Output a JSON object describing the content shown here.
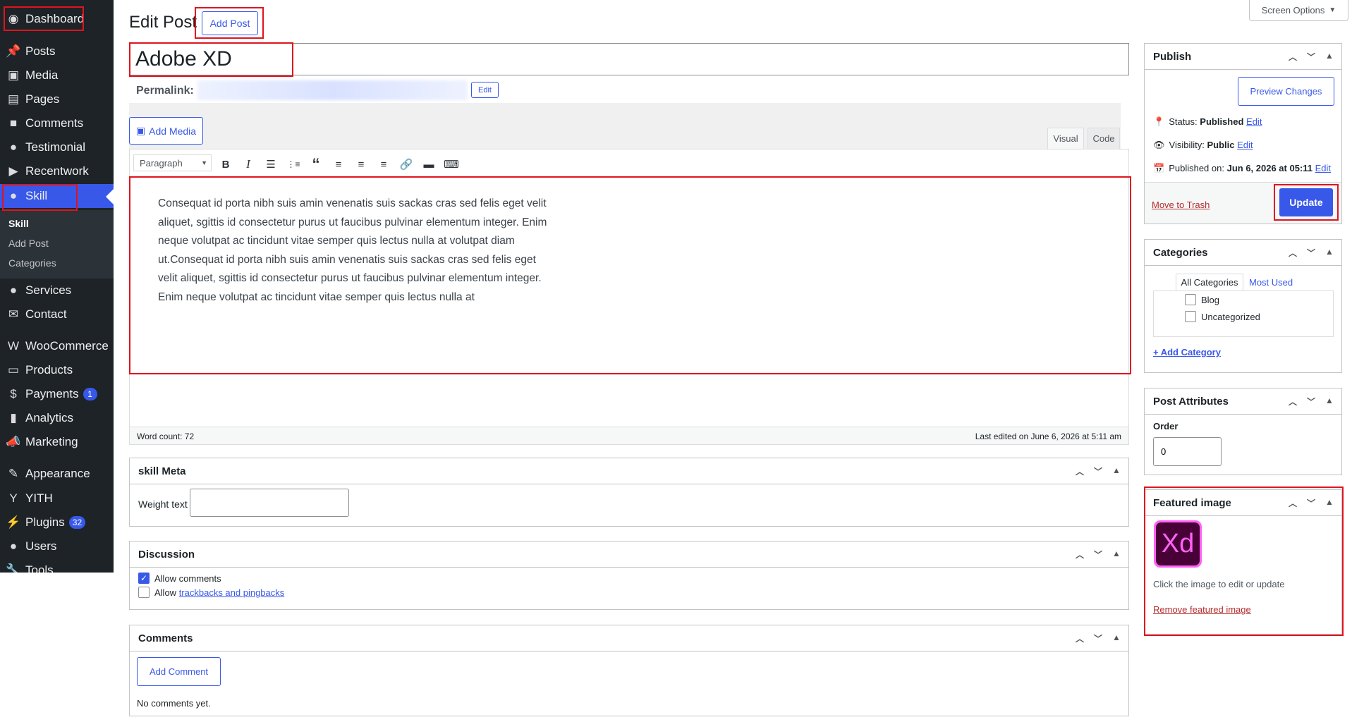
{
  "sidebar": {
    "items": [
      {
        "label": "Dashboard",
        "icon": "dashboard-icon"
      },
      {
        "label": "Posts",
        "icon": "pin-icon"
      },
      {
        "label": "Media",
        "icon": "media-icon"
      },
      {
        "label": "Pages",
        "icon": "pages-icon"
      },
      {
        "label": "Comments",
        "icon": "comments-icon"
      },
      {
        "label": "Testimonial",
        "icon": "user-icon"
      },
      {
        "label": "Recentwork",
        "icon": "video-icon"
      },
      {
        "label": "Skill",
        "icon": "user-icon"
      },
      {
        "label": "Services",
        "icon": "user-icon"
      },
      {
        "label": "Contact",
        "icon": "email-icon"
      },
      {
        "label": "WooCommerce",
        "icon": "woocommerce-icon"
      },
      {
        "label": "Products",
        "icon": "archive-icon"
      },
      {
        "label": "Payments",
        "icon": "dollar-icon",
        "badge": "1"
      },
      {
        "label": "Analytics",
        "icon": "chart-icon"
      },
      {
        "label": "Marketing",
        "icon": "megaphone-icon"
      },
      {
        "label": "Appearance",
        "icon": "brush-icon"
      },
      {
        "label": "YITH",
        "icon": "yith-icon"
      },
      {
        "label": "Plugins",
        "icon": "plug-icon",
        "badge": "32"
      },
      {
        "label": "Users",
        "icon": "user-icon"
      },
      {
        "label": "Tools",
        "icon": "wrench-icon"
      }
    ],
    "submenu": [
      "Skill",
      "Add Post",
      "Categories"
    ]
  },
  "screen_options": "Screen Options",
  "page_title": "Edit Post",
  "add_post_button": "Add Post",
  "post_title": "Adobe XD",
  "permalink_label": "Permalink:",
  "permalink_edit": "Edit",
  "add_media": "Add Media",
  "tabs": {
    "visual": "Visual",
    "code": "Code"
  },
  "format_select": "Paragraph",
  "content_lines": [
    "Consequat id porta nibh suis amin venenatis suis sackas cras sed felis eget velit",
    "aliquet, sgittis id consectetur purus ut faucibus pulvinar elementum integer. Enim",
    "neque volutpat ac tincidunt vitae semper quis lectus nulla at volutpat diam",
    "ut.Consequat id porta nibh suis amin venenatis suis sackas cras sed felis eget",
    "velit aliquet, sgittis id consectetur purus ut faucibus pulvinar elementum integer.",
    "Enim neque volutpat ac tincidunt vitae semper quis lectus nulla at"
  ],
  "word_count": "Word count: 72",
  "last_edited": "Last edited on June 6, 2026 at 5:11 am",
  "skill_meta": {
    "title": "skill Meta",
    "weight_label": "Weight text",
    "weight_value": ""
  },
  "discussion": {
    "title": "Discussion",
    "allow_comments": "Allow comments",
    "allow_prefix": "Allow ",
    "trackbacks": "trackbacks and pingbacks",
    "allow_comments_checked": true,
    "trackbacks_checked": false
  },
  "comments": {
    "title": "Comments",
    "add_button": "Add Comment",
    "none": "No comments yet."
  },
  "publish": {
    "title": "Publish",
    "preview": "Preview Changes",
    "status_label": "Status:",
    "status_value": "Published",
    "visibility_label": "Visibility:",
    "visibility_value": "Public",
    "published_label": "Published on:",
    "published_value": "Jun 6, 2026 at 05:11",
    "edit": "Edit",
    "trash": "Move to Trash",
    "update": "Update"
  },
  "categories": {
    "title": "Categories",
    "tab_all": "All Categories",
    "tab_used": "Most Used",
    "items": [
      "Blog",
      "Uncategorized"
    ],
    "add": "+ Add Category"
  },
  "post_attributes": {
    "title": "Post Attributes",
    "order_label": "Order",
    "order_value": "0"
  },
  "featured_image": {
    "title": "Featured image",
    "logo_text": "Xd",
    "hint": "Click the image to edit or update",
    "remove": "Remove featured image"
  },
  "colors": {
    "accent": "#3858e9",
    "sidebar": "#1d2327",
    "highlight": "#e0141e",
    "xd_bg": "#470137",
    "xd_border": "#ff61f6"
  }
}
